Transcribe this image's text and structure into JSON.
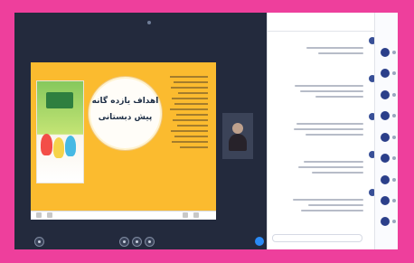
{
  "meeting": {
    "top_items": [
      "",
      ""
    ],
    "side_label": ""
  },
  "slide": {
    "title_line_1": "اهداف یازده گانه",
    "title_line_2": "پیش دبستانی",
    "book_letters": "",
    "footer_text": "",
    "page_indicator": ""
  },
  "chat": {
    "tabs": [
      "",
      ""
    ],
    "messages": [
      {
        "name": ""
      },
      {
        "name": ""
      },
      {
        "name": ""
      },
      {
        "name": ""
      },
      {
        "name": ""
      }
    ],
    "input_placeholder": ""
  },
  "colors": {
    "frame_border": "#ee3f9c",
    "meeting_background": "#232a3d",
    "slide_background": "#fbbb2f",
    "accent": "#2f6ce2"
  },
  "icons": [
    "more-icon",
    "chat-icon",
    "mic-icon",
    "video-icon",
    "leave-icon",
    "user-avatar-icon"
  ]
}
